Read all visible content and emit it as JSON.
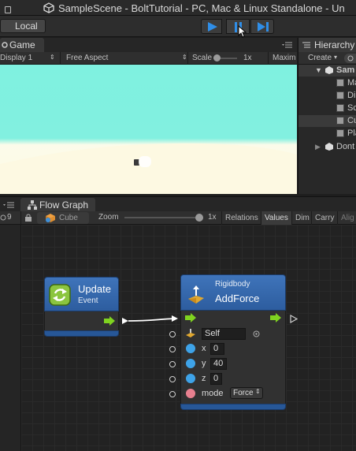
{
  "window": {
    "title": "SampleScene - BoltTutorial - PC, Mac & Linux Standalone - Un"
  },
  "toolbar": {
    "collab_label": "Local"
  },
  "game": {
    "tab_label": "Game",
    "display": "Display 1",
    "aspect": "Free Aspect",
    "scale_label": "Scale",
    "scale_value": "1x",
    "maximize_label": "Maxim"
  },
  "hierarchy": {
    "tab_label": "Hierarchy",
    "create_label": "Create",
    "scene_name": "Sam",
    "items": [
      "Ma",
      "Di",
      "Sc",
      "Cu",
      "Pla"
    ],
    "dont_destroy": "Dont"
  },
  "flow_graph": {
    "tab_label": "Flow Graph",
    "layers_count": "9",
    "object_name": "Cube",
    "zoom_label": "Zoom",
    "zoom_value": "1x",
    "buttons": [
      "Relations",
      "Values",
      "Dim",
      "Carry",
      "Alig"
    ]
  },
  "nodes": {
    "update": {
      "title": "Update",
      "subtitle": "Event"
    },
    "add_force": {
      "category": "Rigidbody",
      "title": "AddForce",
      "target_value": "Self",
      "params": [
        {
          "label": "x",
          "value": "0"
        },
        {
          "label": "y",
          "value": "40"
        },
        {
          "label": "z",
          "value": "0"
        }
      ],
      "mode_label": "mode",
      "mode_value": "Force"
    }
  },
  "colors": {
    "node_header": "#3b6fb6",
    "flow_arrow": "#7fd320",
    "float_port": "#3ea3e8",
    "enum_port": "#e8808f",
    "sky": "#80f0e0",
    "ground": "#fffbe4"
  }
}
